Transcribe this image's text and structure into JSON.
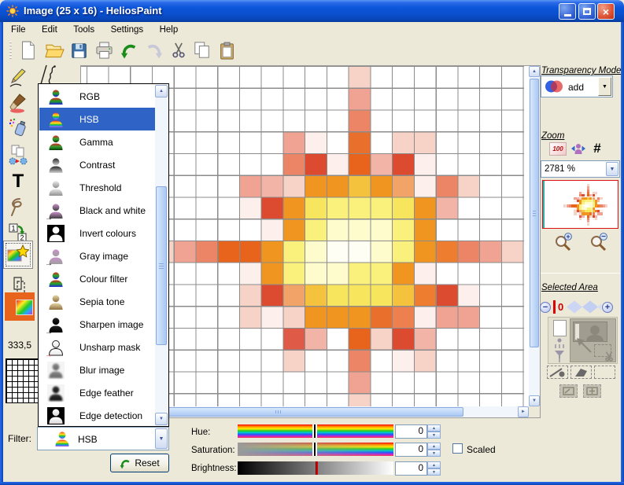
{
  "window": {
    "title": "Image (25 x 16) - HeliosPaint"
  },
  "glyphs": {
    "close": "×",
    "up": "▲",
    "down": "▼",
    "left": "◄",
    "right": "►",
    "plus": "+",
    "minus": "−",
    "hash": "#",
    "text_tool": "T",
    "one": "1",
    "two": "2"
  },
  "menu": {
    "items": [
      "File",
      "Edit",
      "Tools",
      "Settings",
      "Help"
    ]
  },
  "toolbar": {
    "buttons": [
      "new-file",
      "open",
      "save",
      "print",
      "undo",
      "redo",
      "cut",
      "copy",
      "paste"
    ]
  },
  "status": {
    "coordinates": "333,5"
  },
  "filter_list": {
    "selected": "HSB",
    "items": [
      {
        "label": "RGB",
        "icon_spec": {
          "colors": [
            "#e02020",
            "#20a020",
            "#2020e0"
          ]
        }
      },
      {
        "label": "HSB",
        "icon_spec": {
          "colors": [
            "#ff2020",
            "#ffa020",
            "#ffe020",
            "#20c020",
            "#2090ff",
            "#d040d0"
          ]
        }
      },
      {
        "label": "Gamma",
        "icon_spec": {
          "colors": [
            "#e02020",
            "#30a030",
            "#083808"
          ]
        }
      },
      {
        "label": "Contrast",
        "icon_spec": {
          "colors": [
            "#282828",
            "#d0d0d0"
          ]
        }
      },
      {
        "label": "Threshold",
        "icon_spec": {
          "colors": [
            "#e8e8e8",
            "#909090"
          ]
        }
      },
      {
        "label": "Black and white",
        "icon_spec": {
          "colors": [
            "#c890c8",
            "#404040"
          ],
          "arrow": "#111"
        }
      },
      {
        "label": "Invert colours",
        "icon_spec": {
          "colors": [
            "#ffffff"
          ],
          "bg": "#000"
        }
      },
      {
        "label": "Gray image",
        "icon_spec": {
          "colors": [
            "#c890c8",
            "#a0a0a0"
          ],
          "arrow": "#111"
        }
      },
      {
        "label": "Colour filter",
        "icon_spec": {
          "colors": [
            "#dd2222",
            "#22aa22",
            "#2222dd"
          ]
        }
      },
      {
        "label": "Sepia tone",
        "icon_spec": {
          "colors": [
            "#e8d8a8",
            "#907040"
          ]
        }
      },
      {
        "label": "Sharpen image",
        "icon_spec": {
          "colors": [
            "#222222",
            "#000000"
          ],
          "arrow": "#111"
        }
      },
      {
        "label": "Unsharp mask",
        "icon_spec": {
          "colors": [
            "#ffffff",
            "#e8e8e8"
          ],
          "outline": "#222",
          "arrow": "#dd2222"
        }
      },
      {
        "label": "Blur image",
        "icon_spec": {
          "colors": [
            "#888888",
            "#666666"
          ],
          "blur": true,
          "bg": "#f4f4f4"
        }
      },
      {
        "label": "Edge feather",
        "icon_spec": {
          "colors": [
            "#333333",
            "#111111"
          ],
          "blur": true,
          "bg": "#f4f4f4"
        }
      },
      {
        "label": "Edge detection",
        "icon_spec": {
          "colors": [
            "#ffffff",
            "#d8d8d8"
          ],
          "bg": "#000"
        }
      }
    ]
  },
  "filter_bar": {
    "label": "Filter:",
    "combo_value": "HSB",
    "reset_label": "Reset"
  },
  "adjustments": {
    "hue": {
      "label": "Hue:",
      "value": "0"
    },
    "saturation": {
      "label": "Saturation:",
      "value": "0"
    },
    "brightness": {
      "label": "Brightness:",
      "value": "0"
    },
    "scaled_label": "Scaled"
  },
  "right_panel": {
    "transparency": {
      "heading": "Transparency Mode",
      "value": "add"
    },
    "zoom": {
      "heading": "Zoom",
      "level": "2781 %",
      "hundred_label": "100"
    },
    "selected_area": {
      "heading": "Selected Area",
      "value": "0"
    }
  },
  "canvas": {
    "image_size": "25 x 16",
    "palette": {
      "a": "#F7D2C6",
      "b": "#F0A392",
      "c": "#EC8466",
      "d": "#E8702C",
      "e": "#E8631C",
      "f": "#DC4A30",
      "g": "#F0951F",
      "h": "#F8E55E",
      "i": "#FAF07C",
      "j": "#FEFCCC",
      "k": "#FFFEF4",
      "l": "#FDF0EC",
      "m": "#F2B4A6",
      "n": "#EE8050",
      "o": "#F5C23E",
      "p": "#F2A468",
      "q": "#EE7D2F",
      "s": "#E05A48"
    },
    "rows": [
      ".............a.......",
      ".............b.......",
      ".............c.......",
      "..........bl.d.aa....",
      "..........cflemfl....",
      "........bmaggogplca..",
      "........lfghiiihgm...",
      ".........lgijjjig....",
      "....abceegijkkjigqcba",
      "........lgijjiigl....",
      "........afpohhhoqfl..",
      "........alagggdnlbb..",
      "..........sm.eafm....",
      "..........a..c.la....",
      ".............b.......",
      ".............a......."
    ]
  }
}
